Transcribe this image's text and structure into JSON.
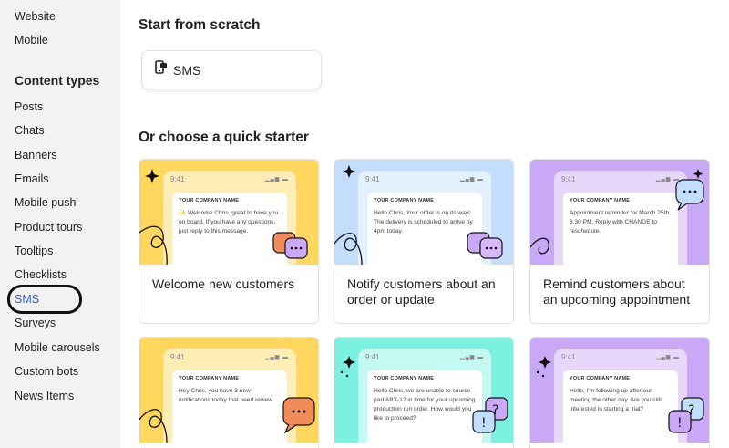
{
  "sidebar": {
    "top_items": [
      {
        "label": "Website"
      },
      {
        "label": "Mobile"
      }
    ],
    "heading": "Content types",
    "items": [
      {
        "label": "Posts"
      },
      {
        "label": "Chats"
      },
      {
        "label": "Banners"
      },
      {
        "label": "Emails"
      },
      {
        "label": "Mobile push"
      },
      {
        "label": "Product tours"
      },
      {
        "label": "Tooltips"
      },
      {
        "label": "Checklists"
      },
      {
        "label": "SMS"
      },
      {
        "label": "Surveys"
      },
      {
        "label": "Mobile carousels"
      },
      {
        "label": "Custom bots"
      },
      {
        "label": "News Items"
      }
    ],
    "active_item": "SMS"
  },
  "main": {
    "scratch_title": "Start from scratch",
    "scratch_button": {
      "label": "SMS",
      "icon": "sms-phone-icon"
    },
    "starters_title": "Or choose a quick starter",
    "cards": [
      {
        "title": "Welcome new customers",
        "bg": "#ffd75e",
        "phone_time": "9:41",
        "company": "YOUR COMPANY NAME",
        "message": "✨ Welcome Chris, great to have you on board. If you have any questions, just reply to this message.",
        "icon": "chat-bubbles-icon"
      },
      {
        "title": "Notify customers about an order or update",
        "bg": "#c3defc",
        "phone_time": "9:41",
        "company": "YOUR COMPANY NAME",
        "message": "Hello Chris, Your order is on its way! The delivery is scheduled to arrive by 4pm today.",
        "icon": "chat-bubbles-icon"
      },
      {
        "title": "Remind customers about an upcoming appointment",
        "bg": "#c9a8f5",
        "phone_time": "9:41",
        "company": "YOUR COMPANY NAME",
        "message": "Appointment reminder for March 25th, 6.30 PM. Reply with CHANGE to reschedule.",
        "icon": "chat-bubble-icon"
      },
      {
        "title": "",
        "bg": "#ffd75e",
        "phone_time": "9:41",
        "company": "YOUR COMPANY NAME",
        "message": "Hey Chris, you have 3 new notifications today that need review.",
        "icon": "chat-bubble-icon"
      },
      {
        "title": "",
        "bg": "#7df1e0",
        "phone_time": "9:41",
        "company": "YOUR COMPANY NAME",
        "message": "Hello Chris, we are unable to source part ABX-12 in time for your upcoming production run order. How would you like to proceed?",
        "icon": "question-exclamation-bubbles-icon"
      },
      {
        "title": "",
        "bg": "#c9a8f5",
        "phone_time": "9:41",
        "company": "YOUR COMPANY NAME",
        "message": "Hello, I'm following up after our meeting the other day. Are you still interested in starting a trial?",
        "icon": "question-exclamation-bubbles-icon"
      }
    ]
  },
  "colors": {
    "sidebar_bg": "#f2f2f2",
    "active_link": "#2a5bd7",
    "card_yellow": "#ffd75e",
    "card_blue": "#c3defc",
    "card_purple": "#c9a8f5",
    "card_teal": "#7df1e0"
  }
}
